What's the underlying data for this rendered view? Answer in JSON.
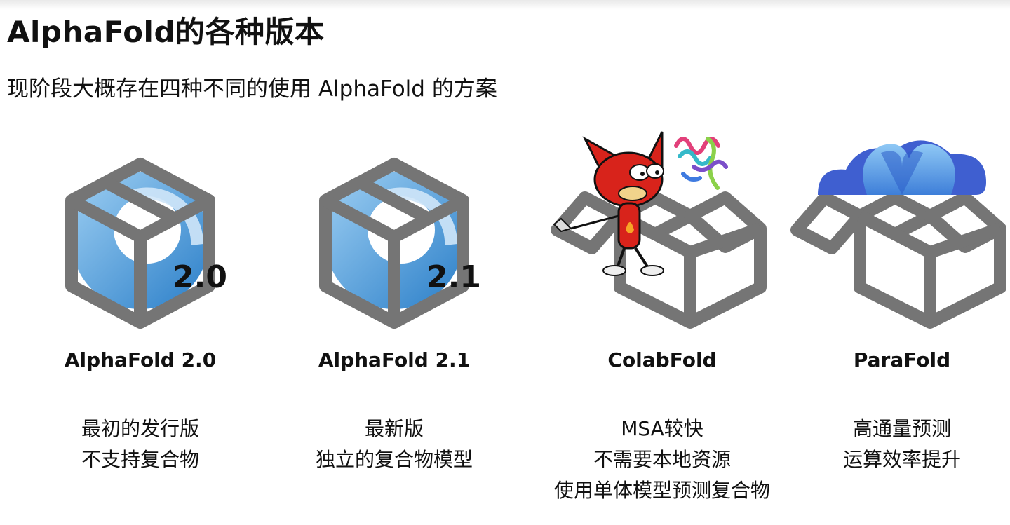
{
  "header": {
    "title": "AlphaFold的各种版本",
    "subtitle": "现阶段大概存在四种不同的使用 AlphaFold 的方案"
  },
  "cards": [
    {
      "name": "AlphaFold 2.0",
      "badge": "2.0",
      "lines": [
        "最初的发行版",
        "不支持复合物"
      ]
    },
    {
      "name": "AlphaFold 2.1",
      "badge": "2.1",
      "lines": [
        "最新版",
        "独立的复合物模型"
      ]
    },
    {
      "name": "ColabFold",
      "lines": [
        "MSA较快",
        "不需要本地资源",
        "使用单体模型预测复合物"
      ]
    },
    {
      "name": "ParaFold",
      "lines": [
        "高通量预测",
        "运算效率提升"
      ]
    }
  ],
  "colors": {
    "box_gray": "#757575",
    "logo_blue": "#2f86d0",
    "logo_light": "#8cc2ee",
    "cloud_blue": "#3f6fd8",
    "mascot_red": "#d8231b"
  }
}
